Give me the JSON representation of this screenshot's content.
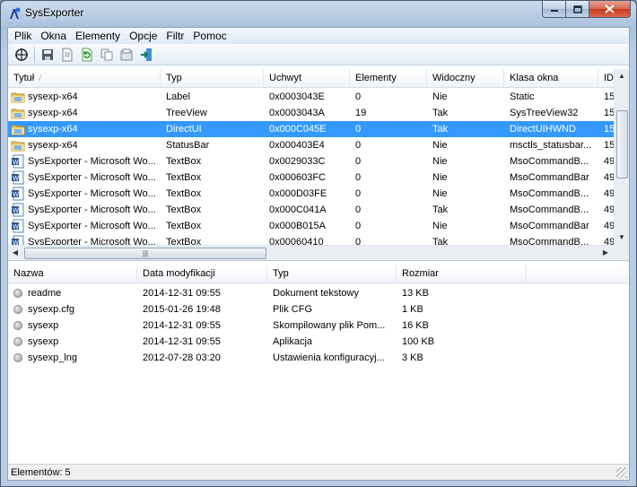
{
  "window": {
    "title": "SysExporter"
  },
  "menu": [
    "Plik",
    "Okna",
    "Elementy",
    "Opcje",
    "Filtr",
    "Pomoc"
  ],
  "toolbar": {
    "icons": [
      "properties-icon",
      "save-icon",
      "document-icon",
      "refresh-icon",
      "copy-icon",
      "html-report-icon",
      "exit-icon"
    ]
  },
  "upper_list": {
    "columns": [
      "Tytuł",
      "Typ",
      "Uchwyt",
      "Elementy",
      "Widoczny",
      "Klasa okna",
      "ID"
    ],
    "rows": [
      {
        "icon": "folder",
        "cells": [
          "sysexp-x64",
          "Label",
          "0x0003043E",
          "0",
          "Nie",
          "Static",
          "15"
        ]
      },
      {
        "icon": "folder",
        "cells": [
          "sysexp-x64",
          "TreeView",
          "0x0003043A",
          "19",
          "Tak",
          "SysTreeView32",
          "15"
        ]
      },
      {
        "icon": "folder",
        "cells": [
          "sysexp-x64",
          "DirectUI",
          "0x000C045E",
          "0",
          "Tak",
          "DirectUIHWND",
          "15"
        ],
        "selected": true
      },
      {
        "icon": "folder",
        "cells": [
          "sysexp-x64",
          "StatusBar",
          "0x000403E4",
          "0",
          "Nie",
          "msctls_statusbar...",
          "15"
        ]
      },
      {
        "icon": "word",
        "cells": [
          "SysExporter - Microsoft Wo...",
          "TextBox",
          "0x0029033C",
          "0",
          "Nie",
          "MsoCommandB...",
          "49"
        ]
      },
      {
        "icon": "word",
        "cells": [
          "SysExporter - Microsoft Wo...",
          "TextBox",
          "0x000603FC",
          "0",
          "Nie",
          "MsoCommandBar",
          "49"
        ]
      },
      {
        "icon": "word",
        "cells": [
          "SysExporter - Microsoft Wo...",
          "TextBox",
          "0x000D03FE",
          "0",
          "Nie",
          "MsoCommandB...",
          "49"
        ]
      },
      {
        "icon": "word",
        "cells": [
          "SysExporter - Microsoft Wo...",
          "TextBox",
          "0x000C041A",
          "0",
          "Tak",
          "MsoCommandB...",
          "49"
        ]
      },
      {
        "icon": "word",
        "cells": [
          "SysExporter - Microsoft Wo...",
          "TextBox",
          "0x000B015A",
          "0",
          "Nie",
          "MsoCommandBar",
          "49"
        ]
      },
      {
        "icon": "word",
        "cells": [
          "SysExporter - Microsoft Wo...",
          "TextBox",
          "0x00060410",
          "0",
          "Tak",
          "MsoCommandB...",
          "49"
        ]
      }
    ]
  },
  "lower_list": {
    "columns": [
      "Nazwa",
      "Data modyfikacji",
      "Typ",
      "Rozmiar"
    ],
    "rows": [
      [
        "readme",
        "2014-12-31 09:55",
        "Dokument tekstowy",
        "13 KB"
      ],
      [
        "sysexp.cfg",
        "2015-01-26 19:48",
        "Plik CFG",
        "1 KB"
      ],
      [
        "sysexp",
        "2014-12-31 09:55",
        "Skompilowany plik Pom...",
        "16 KB"
      ],
      [
        "sysexp",
        "2014-12-31 09:55",
        "Aplikacja",
        "100 KB"
      ],
      [
        "sysexp_lng",
        "2012-07-28 03:20",
        "Ustawienia konfiguracyj...",
        "3 KB"
      ]
    ]
  },
  "status": {
    "text": "Elementów: 5"
  },
  "colors": {
    "selection": "#3399ff",
    "title_gradient": "#a9c1dc",
    "close_button": "#c6391c"
  }
}
